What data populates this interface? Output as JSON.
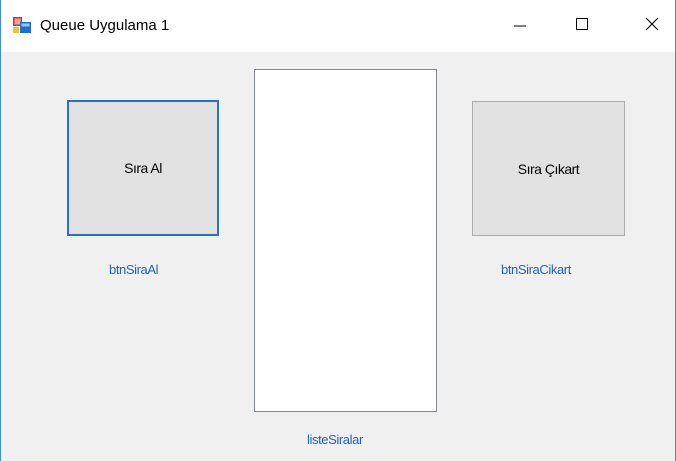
{
  "window": {
    "title": "Queue Uygulama 1",
    "icons": {
      "app": "winforms-app-icon",
      "minimize": "minimize-icon",
      "maximize": "maximize-icon",
      "close": "close-icon"
    },
    "accent_color": "#3a8ee6"
  },
  "form": {
    "buttons": {
      "sira_al": {
        "label": "Sıra Al",
        "name_label": "btnSiraAl"
      },
      "sira_cikart": {
        "label": "Sıra Çıkart",
        "name_label": "btnSiraCikart"
      }
    },
    "listbox": {
      "name_label": "listeSiralar",
      "items": []
    },
    "label_color": "#1f62c0"
  }
}
